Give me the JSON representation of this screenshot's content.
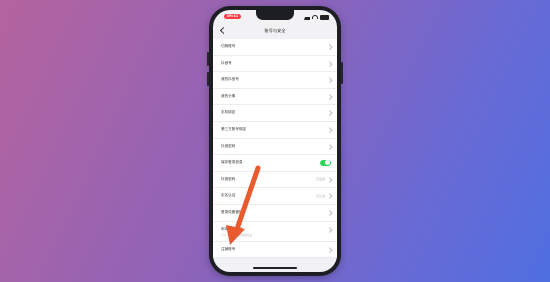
{
  "status_bar": {
    "time": "09:41"
  },
  "nav": {
    "title": "账号与安全"
  },
  "rows": [
    {
      "label": "切换账号",
      "value": "",
      "type": "chevron"
    },
    {
      "label": "抖音号",
      "value": "",
      "type": "chevron"
    },
    {
      "label": "我的抖音号",
      "value": "",
      "type": "chevron"
    },
    {
      "label": "我的头像",
      "value": "",
      "type": "chevron"
    },
    {
      "label": "手机绑定",
      "value": "",
      "type": "chevron"
    },
    {
      "label": "第三方账号绑定",
      "value": "",
      "type": "chevron"
    },
    {
      "label": "抖音密码",
      "value": "",
      "type": "chevron"
    },
    {
      "label": "保存登录信息",
      "value": "",
      "type": "toggle",
      "toggle_on": true
    },
    {
      "label": "抖音密码",
      "value": "已设置",
      "type": "chevron"
    },
    {
      "label": "实名认证",
      "value": "已认证",
      "type": "chevron"
    },
    {
      "label": "登录设备管理",
      "value": "",
      "type": "chevron"
    },
    {
      "label": "申请官方认证",
      "sub": "个人、企业机构等获得认证",
      "value": "",
      "type": "chevron"
    },
    {
      "label": "注销账号",
      "value": "",
      "type": "chevron"
    }
  ],
  "colors": {
    "accent_toggle": "#2fd65b",
    "status_badge": "#ff3b43",
    "arrow": "#ea5a2f"
  }
}
